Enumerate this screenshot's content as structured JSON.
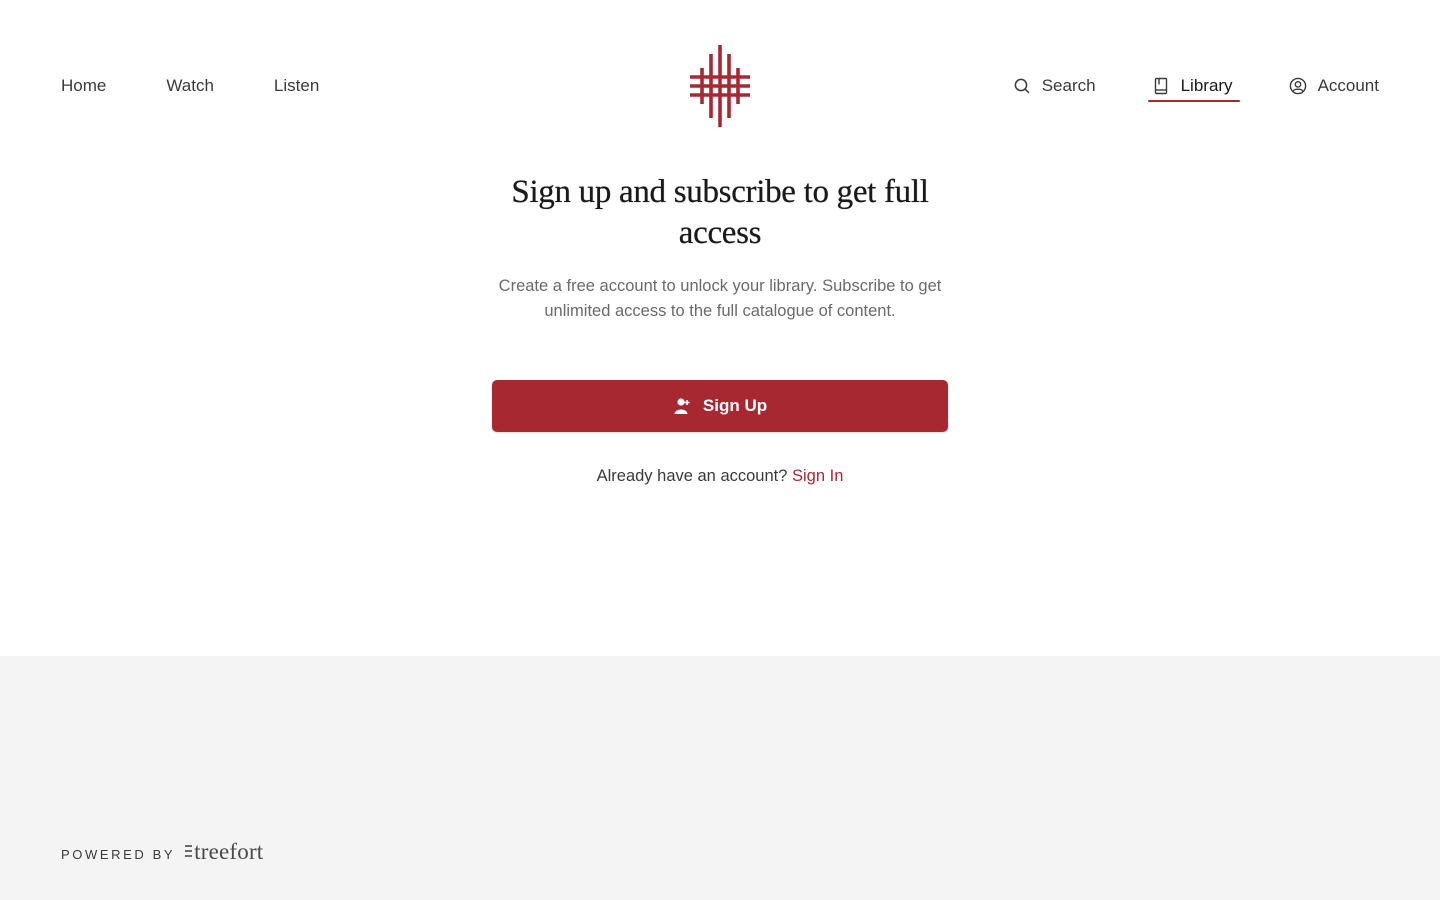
{
  "nav": {
    "left": [
      {
        "label": "Home"
      },
      {
        "label": "Watch"
      },
      {
        "label": "Listen"
      }
    ],
    "right": [
      {
        "label": "Search",
        "icon": "search-icon"
      },
      {
        "label": "Library",
        "icon": "book-icon",
        "active": true
      },
      {
        "label": "Account",
        "icon": "account-icon"
      }
    ]
  },
  "logo": {
    "icon": "hashtag-cross-logo",
    "color": "#a82832"
  },
  "main": {
    "headline": "Sign up and subscribe to get full access",
    "subtext": "Create a free account to unlock your library. Subscribe to get unlimited access to the full catalogue of content.",
    "signup_button": {
      "label": "Sign Up",
      "icon": "user-plus-icon"
    },
    "signin_prompt": "Already have an account?",
    "signin_link": "Sign In"
  },
  "footer": {
    "powered_by": "POWERED BY",
    "brand": "treefort"
  },
  "colors": {
    "accent": "#a82832",
    "footer_bg": "#f4f4f4",
    "text": "#1a1a1a",
    "muted": "#6a6a6a"
  }
}
